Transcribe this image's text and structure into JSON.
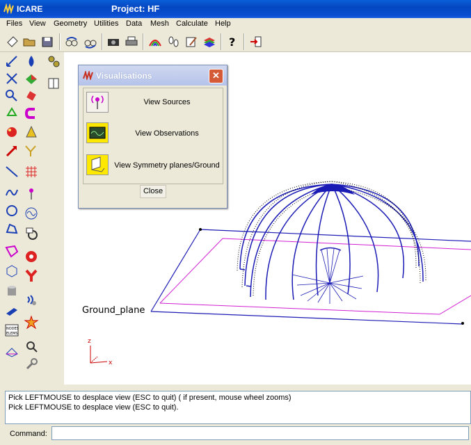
{
  "window": {
    "app_name": "ICARE",
    "project_title": "Project: HF"
  },
  "menu": [
    "Files",
    "View",
    "Geometry",
    "Utilities",
    "Data",
    "Mesh",
    "Calculate",
    "Help"
  ],
  "viewport": {
    "ground_label": "Ground_plane",
    "axis_z": "z",
    "axis_x": "x"
  },
  "dialog": {
    "title": "Visualisations",
    "items": [
      "View Sources",
      "View Observations",
      "View Symmetry planes/Ground"
    ],
    "close_label": "Close"
  },
  "messages": [
    "Pick LEFTMOUSE to desplace view (ESC to quit) ( if present, mouse wheel zooms)",
    "Pick LEFTMOUSE to desplace view (ESC to quit)."
  ],
  "command": {
    "label": "Command:",
    "value": ""
  }
}
